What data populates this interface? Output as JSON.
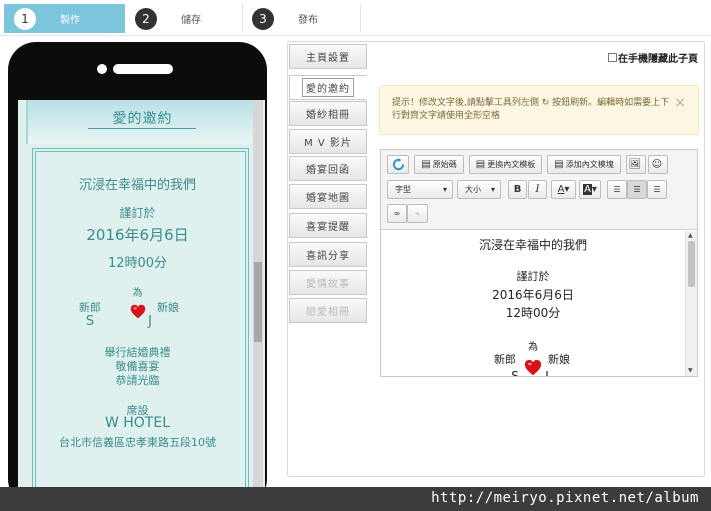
{
  "steps": [
    {
      "num": "1",
      "label": "製作",
      "active": true
    },
    {
      "num": "2",
      "label": "儲存",
      "active": false
    },
    {
      "num": "3",
      "label": "發布",
      "active": false
    }
  ],
  "preview": {
    "title": "愛的邀約",
    "headline": "沉浸在幸福中的我們",
    "engaged_on": "謹訂於",
    "date": "2016年6月6日",
    "time": "12時00分",
    "for": "為",
    "groom_label": "新郎",
    "bride_label": "新娘",
    "groom_initial": "S",
    "bride_initial": "J",
    "ceremony": "舉行結婚典禮",
    "feast": "敬備喜宴",
    "invite": "恭請光臨",
    "venue_label": "席設",
    "venue": "W HOTEL",
    "address": "台北市信義區忠孝東路五段10號"
  },
  "tabs": [
    {
      "label": "主頁設置",
      "state": "normal"
    },
    {
      "label": "愛的邀約",
      "state": "active"
    },
    {
      "label": "婚紗相冊",
      "state": "normal"
    },
    {
      "label": "M V 影片",
      "state": "normal"
    },
    {
      "label": "婚宴回函",
      "state": "normal"
    },
    {
      "label": "婚宴地圖",
      "state": "normal"
    },
    {
      "label": "喜宴提醒",
      "state": "normal"
    },
    {
      "label": "喜訊分享",
      "state": "normal"
    },
    {
      "label": "愛情故事",
      "state": "disabled"
    },
    {
      "label": "戀愛相冊",
      "state": "disabled"
    }
  ],
  "hide_on_phone": {
    "label": "在手機隱藏此子頁",
    "checked": false
  },
  "notice": {
    "text": "提示！修改文字後,請點擊工具列左側 ↻ 按鈕刷新。編輯時如需要上下行對齊文字請使用全形空格",
    "close": "×"
  },
  "toolbar": {
    "source": "原始碼",
    "change_template": "更換內文模板",
    "add_template": "添加內文模塊",
    "font_select": "字型",
    "size_select": "大小",
    "bold": "B",
    "italic": "I",
    "font_color": "A",
    "bg_color": "A"
  },
  "editor_content": {
    "headline": "沉浸在幸福中的我們",
    "engaged_on": "謹訂於",
    "date": "2016年6月6日",
    "time": "12時00分",
    "for": "為",
    "groom_label": "新郎",
    "bride_label": "新娘",
    "groom_initial": "S",
    "bride_initial": "J"
  },
  "watermark": "http://meiryo.pixnet.net/album",
  "colors": {
    "step_active": "#7cc6dd",
    "preview_text": "#3b8b8c",
    "heart": "#d8121b"
  }
}
